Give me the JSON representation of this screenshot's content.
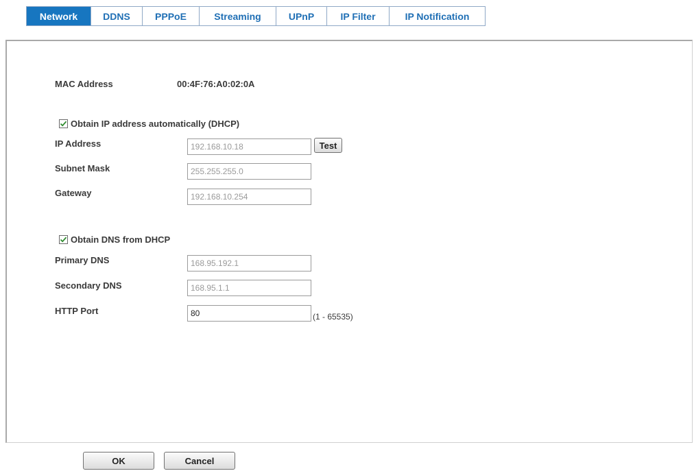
{
  "tabs": [
    {
      "label": "Network",
      "active": true
    },
    {
      "label": "DDNS",
      "active": false
    },
    {
      "label": "PPPoE",
      "active": false
    },
    {
      "label": "Streaming",
      "active": false
    },
    {
      "label": "UPnP",
      "active": false
    },
    {
      "label": "IP Filter",
      "active": false
    },
    {
      "label": "IP Notification",
      "active": false
    }
  ],
  "mac": {
    "label": "MAC Address",
    "value": "00:4F:76:A0:02:0A"
  },
  "dhcp": {
    "label": "Obtain IP address automatically (DHCP)",
    "checked": true
  },
  "ip_address": {
    "label": "IP Address",
    "value": "192.168.10.18",
    "test_label": "Test"
  },
  "subnet_mask": {
    "label": "Subnet Mask",
    "value": "255.255.255.0"
  },
  "gateway": {
    "label": "Gateway",
    "value": "192.168.10.254"
  },
  "dns_dhcp": {
    "label": "Obtain DNS from DHCP",
    "checked": true
  },
  "primary_dns": {
    "label": "Primary DNS",
    "value": "168.95.192.1"
  },
  "secondary_dns": {
    "label": "Secondary DNS",
    "value": "168.95.1.1"
  },
  "http_port": {
    "label": "HTTP Port",
    "value": "80",
    "range": "(1 - 65535)"
  },
  "buttons": {
    "ok": "OK",
    "cancel": "Cancel"
  },
  "colors": {
    "tab_active_bg": "#1776c0",
    "tab_text": "#1f6fb5",
    "check": "#2e8b2e"
  }
}
